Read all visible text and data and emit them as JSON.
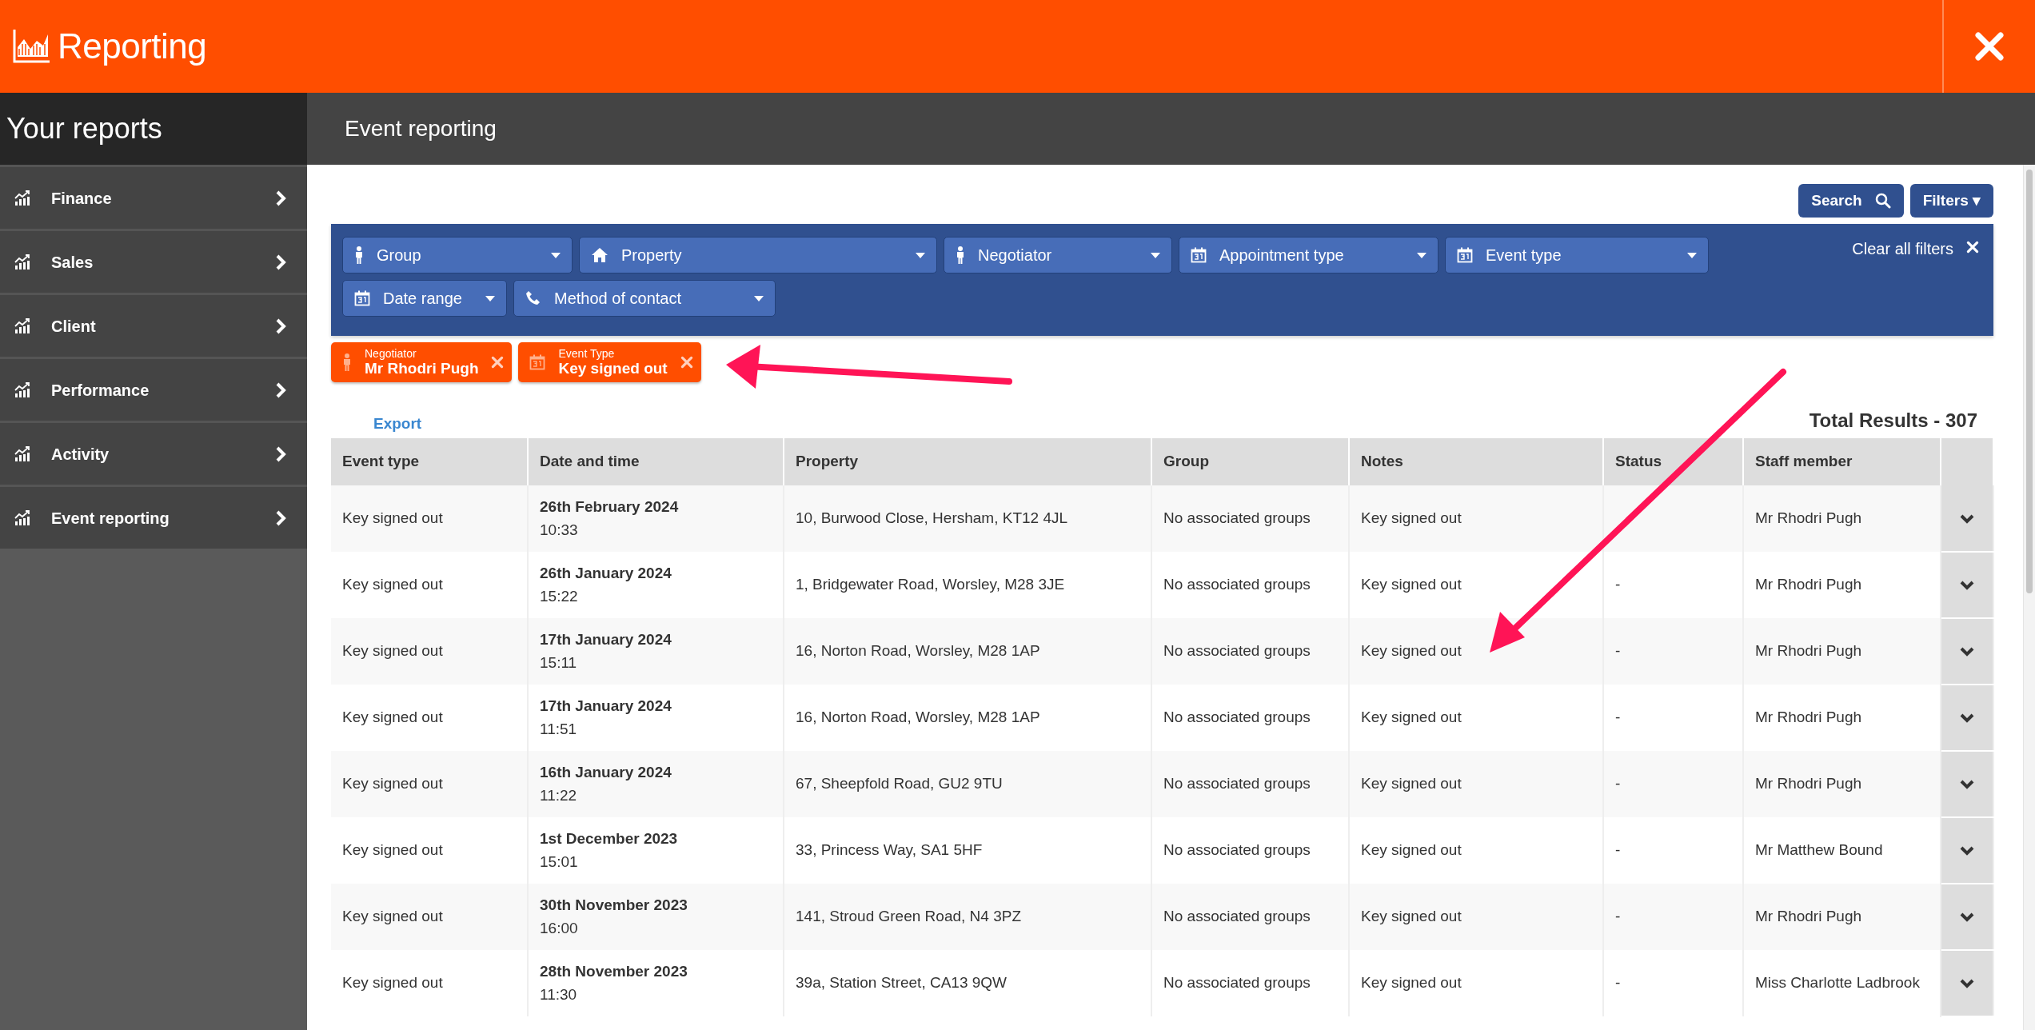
{
  "app": {
    "title": "Reporting"
  },
  "sidebar": {
    "title": "Your reports",
    "items": [
      {
        "label": "Finance"
      },
      {
        "label": "Sales"
      },
      {
        "label": "Client"
      },
      {
        "label": "Performance"
      },
      {
        "label": "Activity"
      },
      {
        "label": "Event reporting"
      }
    ]
  },
  "page": {
    "title": "Event reporting"
  },
  "toolbar": {
    "buttons": [
      {
        "label": "Search",
        "kind": "search"
      },
      {
        "label": "Filters ▾",
        "kind": "menu"
      }
    ]
  },
  "filters": {
    "clear": "Clear all filters",
    "dropdowns": [
      {
        "label": "Group",
        "kind": "person"
      },
      {
        "label": "Property",
        "kind": "house"
      },
      {
        "label": "Negotiator",
        "kind": "person"
      },
      {
        "label": "Appointment type",
        "kind": "calendar"
      },
      {
        "label": "Event type",
        "kind": "calendar"
      },
      {
        "label": "Date range",
        "kind": "calendar"
      },
      {
        "label": "Method of contact",
        "kind": "phone"
      }
    ]
  },
  "chips": [
    {
      "kind": "person",
      "caption": "Negotiator",
      "value": "Mr Rhodri Pugh"
    },
    {
      "kind": "calendar",
      "caption": "Event Type",
      "value": "Key signed out"
    }
  ],
  "export": "Export",
  "total": "Total Results - 307",
  "table": {
    "columns": [
      "Event type",
      "Date and time",
      "Property",
      "Group",
      "Notes",
      "Status",
      "Staff member"
    ],
    "rows": [
      {
        "event_type": "Key signed out",
        "date": "26th February 2024",
        "time": "10:33",
        "property": "10, Burwood Close, Hersham, KT12 4JL",
        "group": "No associated groups",
        "notes": "Key signed out",
        "staff": "Mr Rhodri Pugh"
      },
      {
        "event_type": "Key signed out",
        "date": "26th January 2024",
        "time": "15:22",
        "property": "1, Bridgewater Road, Worsley, M28 3JE",
        "group": "No associated groups",
        "notes": "Key signed out",
        "status": "-",
        "staff": "Mr Rhodri Pugh"
      },
      {
        "event_type": "Key signed out",
        "date": "17th January 2024",
        "time": "15:11",
        "property": "16, Norton Road, Worsley, M28 1AP",
        "group": "No associated groups",
        "notes": "Key signed out",
        "status": "-",
        "staff": "Mr Rhodri Pugh"
      },
      {
        "event_type": "Key signed out",
        "date": "17th January 2024",
        "time": "11:51",
        "property": "16, Norton Road, Worsley, M28 1AP",
        "group": "No associated groups",
        "notes": "Key signed out",
        "status": "-",
        "staff": "Mr Rhodri Pugh"
      },
      {
        "event_type": "Key signed out",
        "date": "16th January 2024",
        "time": "11:22",
        "property": "67, Sheepfold Road, GU2 9TU",
        "group": "No associated groups",
        "notes": "Key signed out",
        "status": "-",
        "staff": "Mr Rhodri Pugh"
      },
      {
        "event_type": "Key signed out",
        "date": "1st December 2023",
        "time": "15:01",
        "property": "33, Princess Way, SA1 5HF",
        "group": "No associated groups",
        "notes": "Key signed out",
        "status": "-",
        "staff": "Mr Matthew Bound"
      },
      {
        "event_type": "Key signed out",
        "date": "30th November 2023",
        "time": "16:00",
        "property": "141, Stroud Green Road, N4 3PZ",
        "group": "No associated groups",
        "notes": "Key signed out",
        "status": "-",
        "staff": "Mr Rhodri Pugh"
      },
      {
        "event_type": "Key signed out",
        "date": "28th November 2023",
        "time": "11:30",
        "property": "39a, Station Street, CA13 9QW",
        "group": "No associated groups",
        "notes": "Key signed out",
        "status": "-",
        "staff": "Miss Charlotte Ladbrook"
      }
    ]
  }
}
